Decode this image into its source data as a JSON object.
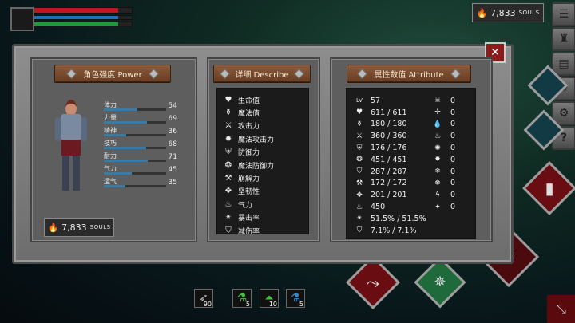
{
  "hud": {
    "souls_amount": "7,833",
    "souls_unit": "SOULS",
    "health_fraction": 0.86,
    "mana_fraction": 0.86,
    "stamina_fraction": 0.86,
    "colors": {
      "health": "#c0161f",
      "mana": "#1f6fb8",
      "stamina": "#1f9a3a"
    }
  },
  "side_menu": [
    {
      "name": "menu-icon",
      "glyph": "☰"
    },
    {
      "name": "armor-icon",
      "glyph": "♜"
    },
    {
      "name": "book-icon",
      "glyph": "▤"
    },
    {
      "name": "compass-icon",
      "glyph": "✷"
    },
    {
      "name": "gear-icon",
      "glyph": "⚙"
    },
    {
      "name": "help-icon",
      "glyph": "?"
    }
  ],
  "power": {
    "title": "角色强度 Power",
    "stats": [
      {
        "label": "体力",
        "value": "54",
        "fraction": 0.54
      },
      {
        "label": "力量",
        "value": "69",
        "fraction": 0.69
      },
      {
        "label": "精神",
        "value": "36",
        "fraction": 0.36
      },
      {
        "label": "技巧",
        "value": "68",
        "fraction": 0.68
      },
      {
        "label": "耐力",
        "value": "71",
        "fraction": 0.71
      },
      {
        "label": "气力",
        "value": "45",
        "fraction": 0.45
      },
      {
        "label": "运气",
        "value": "35",
        "fraction": 0.35
      }
    ],
    "souls_amount": "7,833",
    "souls_unit": "SOULS"
  },
  "describe": {
    "title": "详细 Describe",
    "items": [
      {
        "icon": "heart-icon",
        "glyph": "♥",
        "label": "生命值"
      },
      {
        "icon": "mana-flask-icon",
        "glyph": "⚱",
        "label": "魔法值"
      },
      {
        "icon": "sword-icon",
        "glyph": "⚔",
        "label": "攻击力"
      },
      {
        "icon": "magic-attack-icon",
        "glyph": "✹",
        "label": "魔法攻击力"
      },
      {
        "icon": "shield-icon",
        "glyph": "⛨",
        "label": "防御力"
      },
      {
        "icon": "magic-shield-icon",
        "glyph": "❂",
        "label": "魔法防御力"
      },
      {
        "icon": "break-icon",
        "glyph": "⚒",
        "label": "崩解力"
      },
      {
        "icon": "toughness-icon",
        "glyph": "✥",
        "label": "坚韧性"
      },
      {
        "icon": "flask-icon",
        "glyph": "♨",
        "label": "气力"
      },
      {
        "icon": "crit-icon",
        "glyph": "✴",
        "label": "暴击率"
      },
      {
        "icon": "reduction-icon",
        "glyph": "⛉",
        "label": "减伤率"
      }
    ]
  },
  "attribute": {
    "title": "属性数值 Attribute",
    "rows": [
      {
        "icon": "level-icon",
        "glyph": "LV",
        "value": "57",
        "icon2": "skull-icon",
        "glyph2": "☠",
        "value2": "0"
      },
      {
        "icon": "heart-icon",
        "glyph": "♥",
        "value": "611 / 611",
        "icon2": "bleed-icon",
        "glyph2": "✢",
        "value2": "0"
      },
      {
        "icon": "mana-flask-icon",
        "glyph": "⚱",
        "value": "180 / 180",
        "icon2": "poison-icon",
        "glyph2": "💧",
        "value2": "0"
      },
      {
        "icon": "sword-icon",
        "glyph": "⚔",
        "value": "360 / 360",
        "icon2": "fire-icon",
        "glyph2": "♨",
        "value2": "0"
      },
      {
        "icon": "shield-icon",
        "glyph": "⛨",
        "value": "176 / 176",
        "icon2": "flame-icon",
        "glyph2": "✺",
        "value2": "0"
      },
      {
        "icon": "magic-shield-icon",
        "glyph": "❂",
        "value": "451 / 451",
        "icon2": "burn-icon",
        "glyph2": "✸",
        "value2": "0"
      },
      {
        "icon": "armor-icon",
        "glyph": "⛉",
        "value": "287 / 287",
        "icon2": "frost-icon",
        "glyph2": "❄",
        "value2": "0"
      },
      {
        "icon": "break-icon",
        "glyph": "⚒",
        "value": "172 / 172",
        "icon2": "ice-icon",
        "glyph2": "❅",
        "value2": "0"
      },
      {
        "icon": "toughness-icon",
        "glyph": "✥",
        "value": "201 / 201",
        "icon2": "lightning-icon",
        "glyph2": "ϟ",
        "value2": "0"
      },
      {
        "icon": "flask-icon",
        "glyph": "♨",
        "value": "450",
        "icon2": "spark-icon",
        "glyph2": "✦",
        "value2": "0"
      },
      {
        "icon": "crit-icon",
        "glyph": "✴",
        "value": "51.5% / 51.5%",
        "icon2": "",
        "glyph2": "",
        "value2": ""
      },
      {
        "icon": "reduction-icon",
        "glyph": "⛉",
        "value": "7.1% / 7.1%",
        "icon2": "",
        "glyph2": "",
        "value2": ""
      }
    ]
  },
  "hotbar": {
    "arrows_count": "90",
    "green_potion_count": "5",
    "green_flask_count": "10",
    "blue_potion_count": "5"
  }
}
